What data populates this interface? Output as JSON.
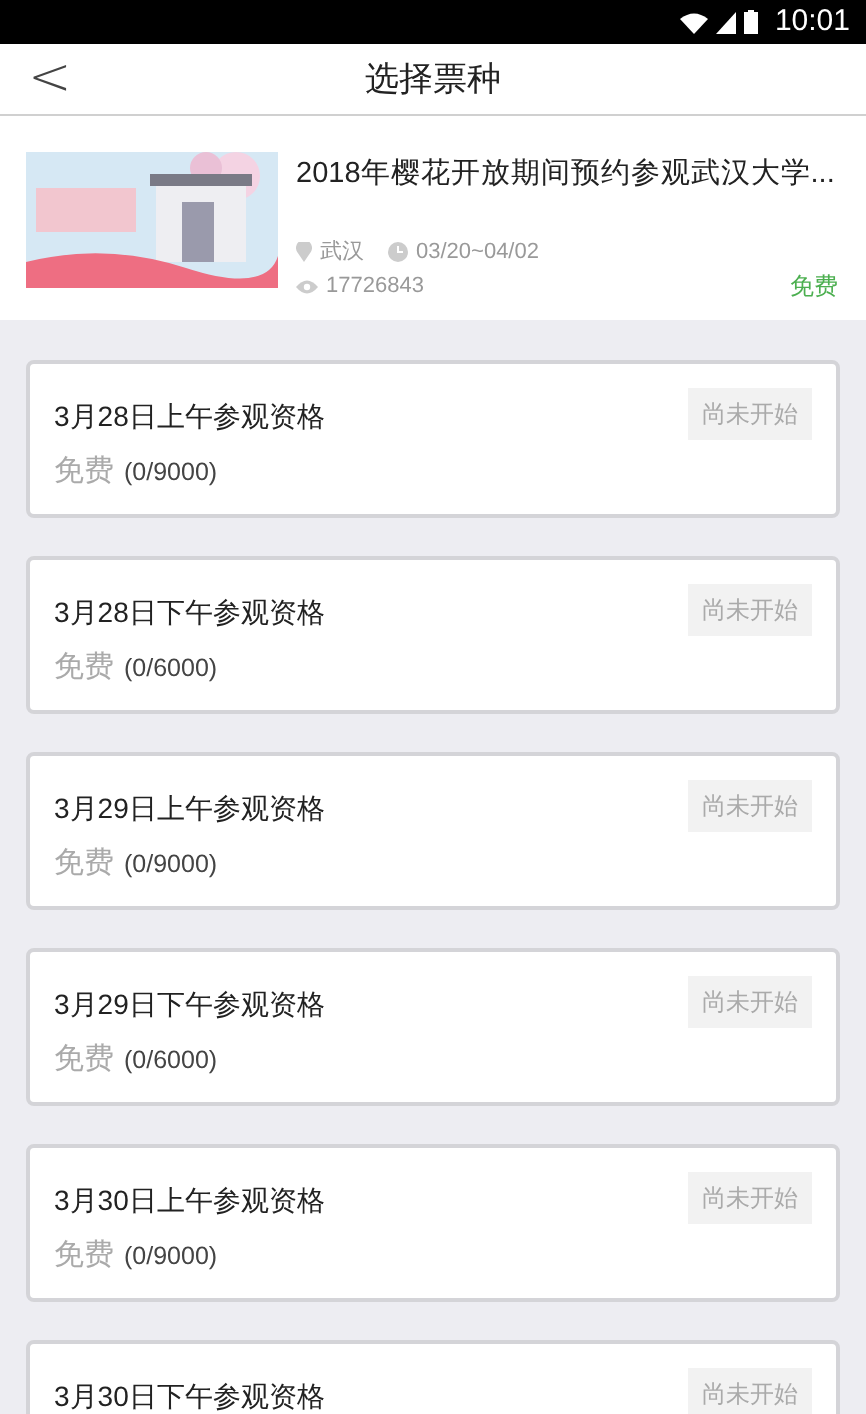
{
  "status_bar": {
    "time": "10:01"
  },
  "header": {
    "back": "<",
    "title": "选择票种"
  },
  "event": {
    "title": "2018年樱花开放期间预约参观武汉大学...",
    "city": "武汉",
    "dates": "03/20~04/02",
    "views": "17726843",
    "price": "免费"
  },
  "tickets": [
    {
      "name": "3月28日上午参观资格",
      "status": "尚未开始",
      "price": "免费",
      "quota": "(0/9000)"
    },
    {
      "name": "3月28日下午参观资格",
      "status": "尚未开始",
      "price": "免费",
      "quota": "(0/6000)"
    },
    {
      "name": "3月29日上午参观资格",
      "status": "尚未开始",
      "price": "免费",
      "quota": "(0/9000)"
    },
    {
      "name": "3月29日下午参观资格",
      "status": "尚未开始",
      "price": "免费",
      "quota": "(0/6000)"
    },
    {
      "name": "3月30日上午参观资格",
      "status": "尚未开始",
      "price": "免费",
      "quota": "(0/9000)"
    },
    {
      "name": "3月30日下午参观资格",
      "status": "尚未开始"
    }
  ]
}
